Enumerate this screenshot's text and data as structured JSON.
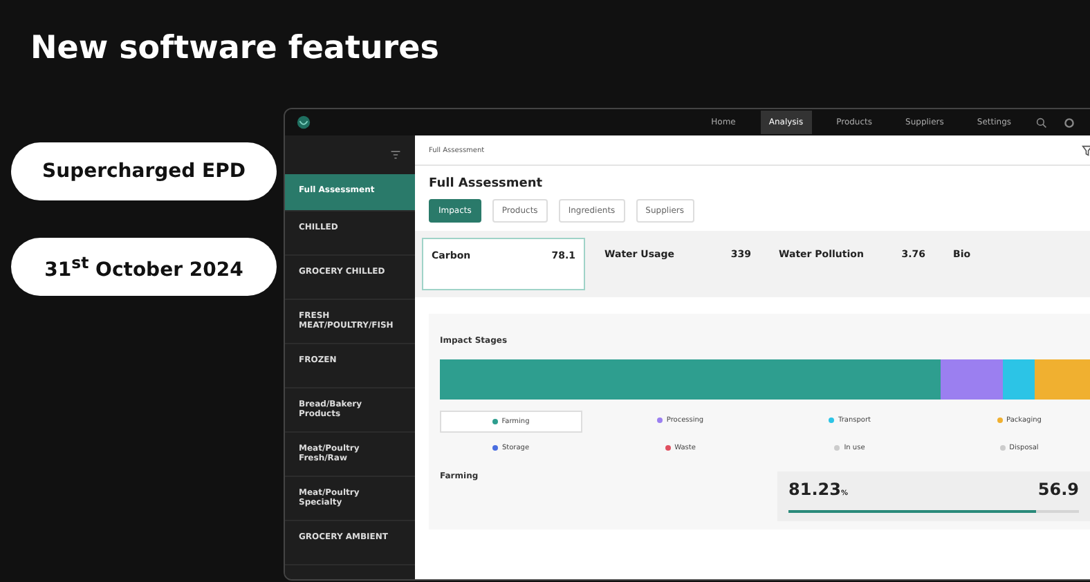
{
  "title": "New software features",
  "badges": [
    "Supercharged EPD",
    "31$^{st}$ October 2024"
  ],
  "nav": [
    {
      "label": "Home",
      "selected": false
    },
    {
      "label": "Analysis",
      "selected": true
    },
    {
      "label": "Products",
      "selected": false
    },
    {
      "label": "Suppliers",
      "selected": false
    },
    {
      "label": "Settings",
      "selected": false
    }
  ],
  "sidebar": [
    {
      "name": "Full Assessment",
      "selected": true
    },
    {
      "name": "CHILLED",
      "selected": false
    },
    {
      "name": "GROCERY CHILLED",
      "selected": false
    },
    {
      "name": "FRESH MEAT/POULTRY/FISH",
      "selected": false
    },
    {
      "name": "FROZEN",
      "selected": false
    },
    {
      "name": "Bread/Bakery Products",
      "selected": false
    },
    {
      "name": "Meat/Poultry Fresh/Raw",
      "selected": false
    },
    {
      "name": "Meat/Poultry Specialty",
      "selected": false
    },
    {
      "name": "GROCERY AMBIENT",
      "selected": false
    }
  ],
  "breadcrumb": "Full Assessment",
  "heading": "Full Assessment",
  "tabs": [
    {
      "label": "Impacts",
      "selected": true
    },
    {
      "label": "Products",
      "selected": false
    },
    {
      "label": "Ingredients",
      "selected": false
    },
    {
      "label": "Suppliers",
      "selected": false
    }
  ],
  "metrics": [
    {
      "name": "Carbon",
      "value": "78.1",
      "selected": true
    },
    {
      "name": "Water Usage",
      "value": "339",
      "selected": false
    },
    {
      "name": "Water Pollution",
      "value": "3.76",
      "selected": false
    },
    {
      "name": "Bio",
      "selected": false
    }
  ],
  "stages_title": "Impact Stages",
  "stages": [
    {
      "label": "Farming",
      "color": "#2e9e8f",
      "selected": true
    },
    {
      "label": "Processing",
      "color": "#9b7ff0",
      "selected": false
    },
    {
      "label": "Transport",
      "color": "#2cc4e6",
      "selected": false
    },
    {
      "label": "Packaging",
      "color": "#f0b030",
      "selected": false
    },
    {
      "label": "Storage",
      "color": "#4a6ee0",
      "selected": false
    },
    {
      "label": "Waste",
      "color": "#e05060",
      "selected": false
    },
    {
      "label": "In use",
      "color": "#cccccc",
      "selected": false
    },
    {
      "label": "Disposal",
      "color": "#cccccc",
      "selected": false
    }
  ],
  "detail": {
    "title": "Farming",
    "stats": [
      {
        "value": "81.23",
        "unit": "%"
      },
      {
        "value": "56.9"
      }
    ],
    "level": 0.85
  }
}
